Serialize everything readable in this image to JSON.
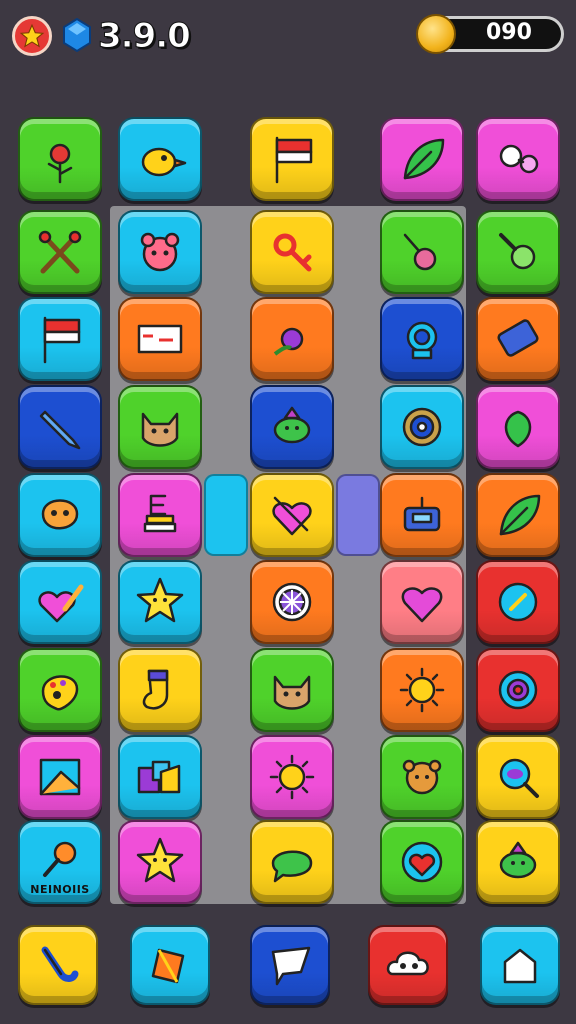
{
  "hud": {
    "level_icon": "star-icon",
    "gem_icon": "gem-icon",
    "gem_count": "3.9.0",
    "coin_icon": "coin-icon",
    "coin_count": "090"
  },
  "colors": {
    "background": "#3d3842",
    "board": "#8e8d91",
    "green": "#4fd22b",
    "cyan": "#1cc3ef",
    "yellow": "#ffd21a",
    "pink": "#f04fd8",
    "orange": "#ff7a1f",
    "blue": "#1d4fd1",
    "red": "#e8312f",
    "salmon": "#ff7e86"
  },
  "grid": [
    {
      "color": "#4fd22b",
      "icon": "flower-icon"
    },
    {
      "color": "#1cc3ef",
      "icon": "bird-icon"
    },
    {
      "color": "#ffd21a",
      "icon": "flag-icon"
    },
    {
      "color": "#f04fd8",
      "icon": "leaf-icon"
    },
    {
      "color": "#f04fd8",
      "icon": "gear-link-icon"
    },
    {
      "color": "#4fd22b",
      "icon": "crossed-tools-icon"
    },
    {
      "color": "#1cc3ef",
      "icon": "bear-face-icon"
    },
    {
      "color": "#ffd21a",
      "icon": "key-icon"
    },
    {
      "color": "#4fd22b",
      "icon": "guitar-icon"
    },
    {
      "color": "#4fd22b",
      "icon": "wrench-icon"
    },
    {
      "color": "#1cc3ef",
      "icon": "flag-icon"
    },
    {
      "color": "#ff7a1f",
      "icon": "banner-icon"
    },
    {
      "color": "#ff7a1f",
      "icon": "purple-flower-icon"
    },
    {
      "color": "#1d4fd1",
      "icon": "ring-icon"
    },
    {
      "color": "#ff7a1f",
      "icon": "battery-icon"
    },
    {
      "color": "#1d4fd1",
      "icon": "pencil-icon"
    },
    {
      "color": "#4fd22b",
      "icon": "cat-face-icon"
    },
    {
      "color": "#1d4fd1",
      "icon": "turtle-icon"
    },
    {
      "color": "#1cc3ef",
      "icon": "target-wheel-icon"
    },
    {
      "color": "#f04fd8",
      "icon": "berry-icon"
    },
    {
      "color": "#1cc3ef",
      "icon": "blob-face-icon"
    },
    {
      "color": "#f04fd8",
      "icon": "books-icon"
    },
    {
      "color": "#ffd21a",
      "icon": "heart-arrow-icon"
    },
    {
      "color": "#ff7a1f",
      "icon": "robot-icon"
    },
    {
      "color": "#ff7a1f",
      "icon": "leaf-icon"
    },
    {
      "color": "#1cc3ef",
      "icon": "heart-pencil-icon"
    },
    {
      "color": "#1cc3ef",
      "icon": "star-face-icon"
    },
    {
      "color": "#ff7a1f",
      "icon": "wheel-icon"
    },
    {
      "color": "#ff7e86",
      "icon": "heart-icon"
    },
    {
      "color": "#e8312f",
      "icon": "compass-icon"
    },
    {
      "color": "#4fd22b",
      "icon": "palette-icon"
    },
    {
      "color": "#ffd21a",
      "icon": "sock-icon"
    },
    {
      "color": "#4fd22b",
      "icon": "cat-face-icon"
    },
    {
      "color": "#ff7a1f",
      "icon": "sun-icon"
    },
    {
      "color": "#e8312f",
      "icon": "dial-icon"
    },
    {
      "color": "#f04fd8",
      "icon": "picture-icon"
    },
    {
      "color": "#1cc3ef",
      "icon": "shapes-icon"
    },
    {
      "color": "#f04fd8",
      "icon": "sun-icon"
    },
    {
      "color": "#4fd22b",
      "icon": "lion-face-icon"
    },
    {
      "color": "#ffd21a",
      "icon": "magnifier-icon"
    },
    {
      "color": "#1cc3ef",
      "icon": "maraca-icon",
      "caption": "NEINOIIS"
    },
    {
      "color": "#f04fd8",
      "icon": "star-face-icon"
    },
    {
      "color": "#ffd21a",
      "icon": "chat-bubble-icon"
    },
    {
      "color": "#4fd22b",
      "icon": "heart-globe-icon"
    },
    {
      "color": "#ffd21a",
      "icon": "turtle-icon"
    }
  ],
  "dock": [
    {
      "color": "#ffd21a",
      "icon": "hook-icon"
    },
    {
      "color": "#1cc3ef",
      "icon": "gem-icon"
    },
    {
      "color": "#1d4fd1",
      "icon": "speech-icon"
    },
    {
      "color": "#e8312f",
      "icon": "cloud-icon"
    },
    {
      "color": "#1cc3ef",
      "icon": "house-icon"
    }
  ],
  "slots": [
    {
      "color": "#1cc3ef"
    },
    {
      "color": "#7a7ae0"
    }
  ]
}
